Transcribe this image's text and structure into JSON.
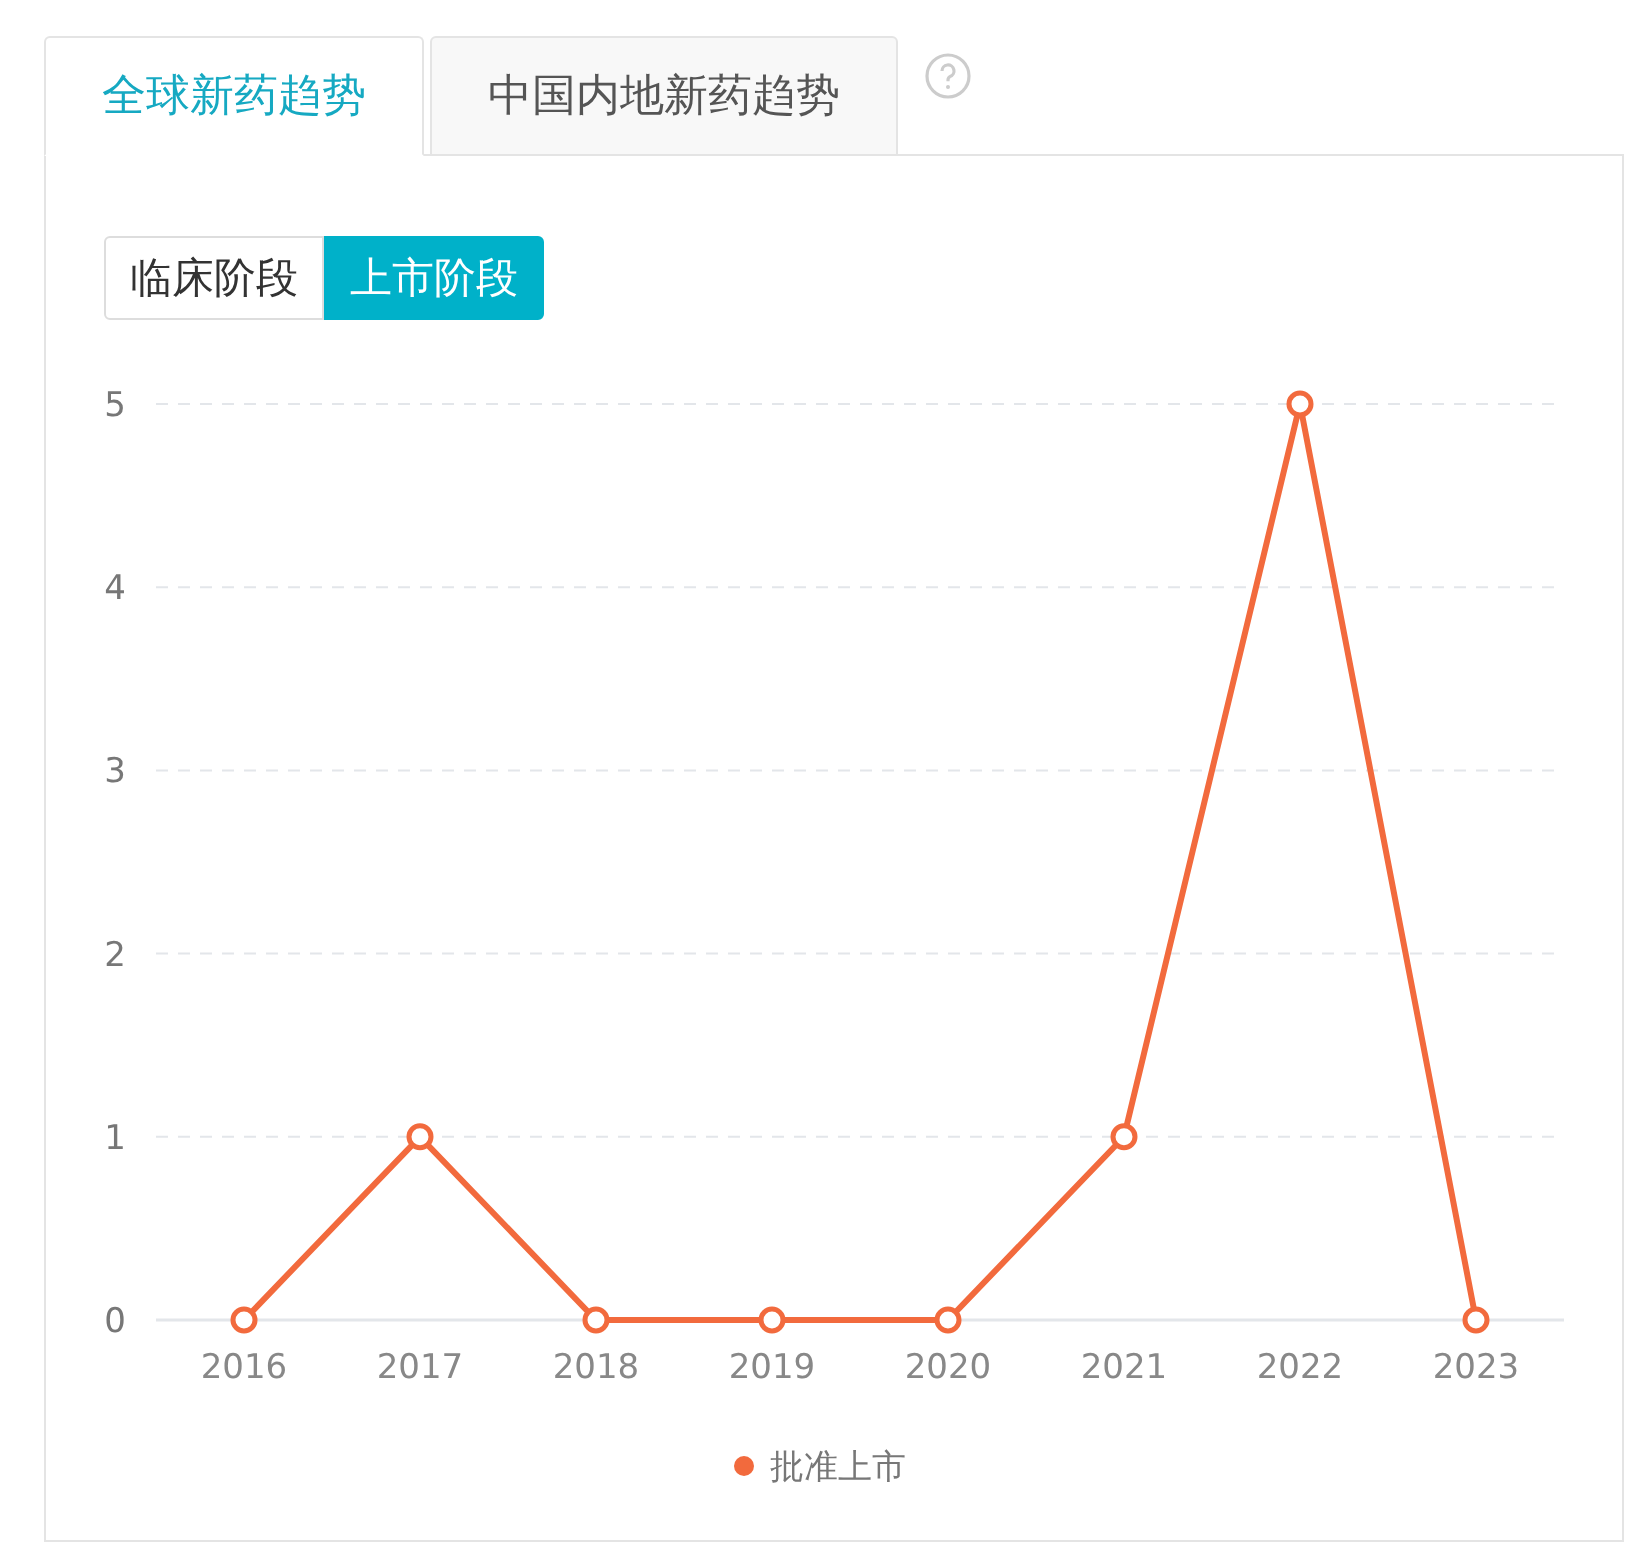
{
  "tabs": [
    {
      "label": "全球新药趋势",
      "selected": true
    },
    {
      "label": "中国内地新药趋势",
      "selected": false
    }
  ],
  "stage_toggle": [
    {
      "label": "临床阶段",
      "selected": false
    },
    {
      "label": "上市阶段",
      "selected": true
    }
  ],
  "chart_data": {
    "type": "line",
    "grid": true,
    "categories": [
      "2016",
      "2017",
      "2018",
      "2019",
      "2020",
      "2021",
      "2022",
      "2023"
    ],
    "yticks": [
      0,
      1,
      2,
      3,
      4,
      5
    ],
    "ylim": [
      0,
      5
    ],
    "series": [
      {
        "name": "批准上市",
        "color": "#f26a3d",
        "marker": "hollow-circle",
        "values": [
          0,
          1,
          0,
          0,
          0,
          1,
          5,
          0
        ]
      }
    ]
  }
}
